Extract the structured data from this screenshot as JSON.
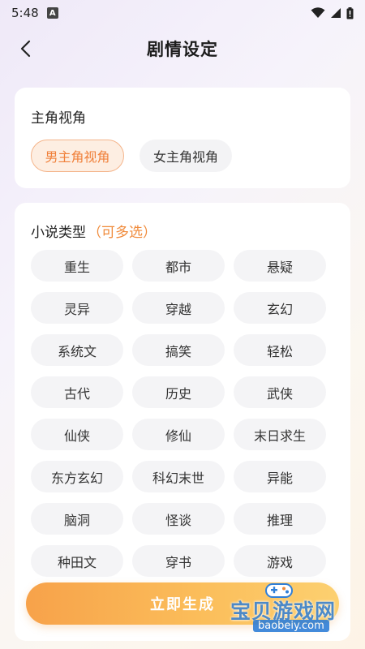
{
  "status_bar": {
    "time": "5:48",
    "notification": "A"
  },
  "header": {
    "title": "剧情设定"
  },
  "pov": {
    "title": "主角视角",
    "options": [
      "男主角视角",
      "女主角视角"
    ],
    "selected": "男主角视角",
    "accent_color": "#f0803a"
  },
  "genre": {
    "title": "小说类型",
    "hint": "（可多选）",
    "options": [
      "重生",
      "都市",
      "悬疑",
      "灵异",
      "穿越",
      "玄幻",
      "系统文",
      "搞笑",
      "轻松",
      "古代",
      "历史",
      "武侠",
      "仙侠",
      "修仙",
      "末日求生",
      "东方玄幻",
      "科幻末世",
      "异能",
      "脑洞",
      "怪谈",
      "推理",
      "种田文",
      "穿书",
      "游戏"
    ]
  },
  "generate_button": {
    "label": "立即生成"
  },
  "watermark": {
    "text": "宝贝游戏网",
    "url": "baobeiy.com"
  },
  "icons": {
    "back": "chevron-left-icon",
    "wifi": "wifi-icon",
    "signal": "signal-icon",
    "battery": "battery-icon"
  }
}
